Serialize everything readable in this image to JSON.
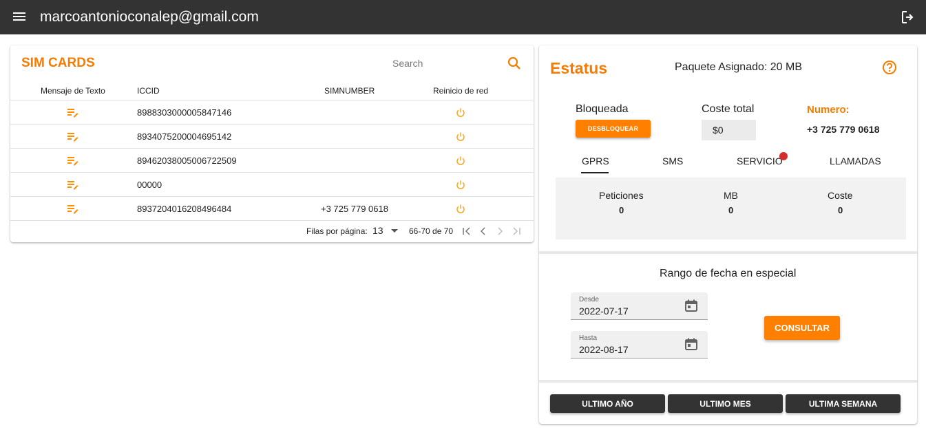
{
  "appbar": {
    "title": "marcoantonioconalep@gmail.com",
    "menu_icon": "menu-icon",
    "logout_icon": "logout-icon",
    "background": "#333333"
  },
  "sim_cards": {
    "title": "SIM CARDS",
    "search_placeholder": "Search",
    "columns": [
      "Mensaje de Texto",
      "ICCID",
      "SIMNUMBER",
      "Reinicio de red"
    ],
    "rows": [
      {
        "iccid": "8988303000005847146",
        "simnumber": ""
      },
      {
        "iccid": "8934075200004695142",
        "simnumber": ""
      },
      {
        "iccid": "89462038005006722509",
        "simnumber": ""
      },
      {
        "iccid": "00000",
        "simnumber": ""
      },
      {
        "iccid": "8937204016208496484",
        "simnumber": "+3 725 779 0618"
      }
    ],
    "pagination": {
      "rows_label": "Filas por página:",
      "rows_per_page": "13",
      "range": "66-70 de 70"
    }
  },
  "status": {
    "title": "Estatus",
    "package": "Paquete Asignado: 20 MB",
    "blocked_label": "Bloqueada",
    "unlock_button": "DESBLOQUEAR",
    "cost_label": "Coste total",
    "cost_value": "$0",
    "number_label": "Numero:",
    "number_value": "+3 725 779 0618",
    "tabs": [
      "GPRS",
      "SMS",
      "SERVICIO",
      "LLAMADAS"
    ],
    "active_tab": "GPRS",
    "stats": {
      "headers": [
        "Peticiones",
        "MB",
        "Coste"
      ],
      "values": [
        "0",
        "0",
        "0"
      ]
    },
    "date_range": {
      "title": "Rango de fecha en especial",
      "from_label": "Desde",
      "from_value": "2022-07-17",
      "to_label": "Hasta",
      "to_value": "2022-08-17",
      "consult_button": "CONSULTAR"
    },
    "quick_buttons": [
      "ULTIMO AÑO",
      "ULTIMO MES",
      "ULTIMA SEMANA"
    ]
  },
  "colors": {
    "accent": "#ff7f00",
    "title_orange": "#f57c00",
    "dark": "#333333",
    "badge": "#d32f2f",
    "reset_icon": "#f9a825"
  }
}
